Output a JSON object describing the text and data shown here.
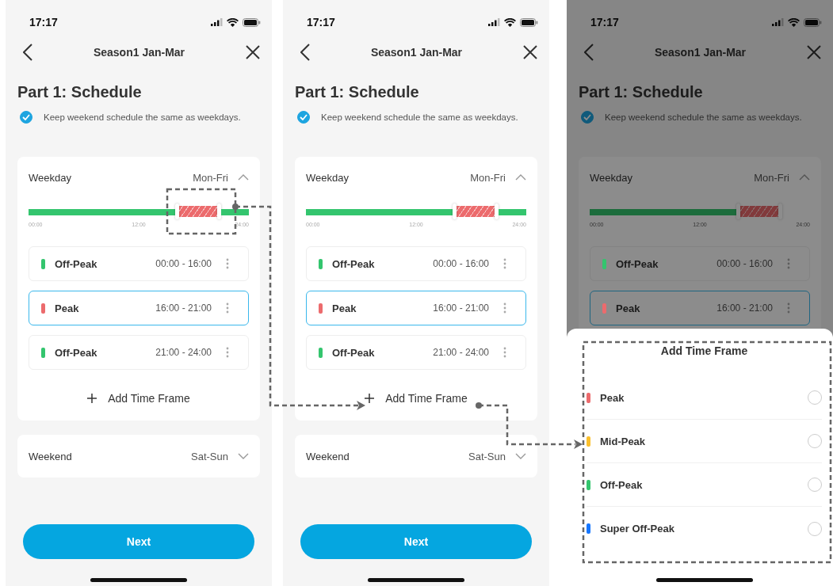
{
  "screens": [
    {
      "status_time": "17:17",
      "title": "Season1 Jan-Mar",
      "heading": "Part 1: Schedule",
      "keep_same": {
        "label": "Keep weekend schedule the same as weekdays.",
        "checked": true
      },
      "weekday": {
        "label": "Weekday",
        "days": "Mon-Fri",
        "expanded": true,
        "ticks": [
          "00:00",
          "12:00",
          "24:00"
        ],
        "frames": [
          {
            "label": "Off-Peak",
            "time": "00:00 - 16:00",
            "color": "#34c56e",
            "selected": false
          },
          {
            "label": "Peak",
            "time": "16:00 - 21:00",
            "color": "#ec6b6d",
            "selected": true
          },
          {
            "label": "Off-Peak",
            "time": "21:00 - 24:00",
            "color": "#34c56e",
            "selected": false
          }
        ],
        "add_label": "Add Time Frame"
      },
      "weekend": {
        "label": "Weekend",
        "days": "Sat-Sun",
        "expanded": false
      },
      "next_button": "Next"
    },
    {
      "status_time": "17:17",
      "title": "Season1 Jan-Mar",
      "heading": "Part 1: Schedule",
      "keep_same": {
        "label": "Keep weekend schedule the same as weekdays.",
        "checked": true
      },
      "weekday": {
        "label": "Weekday",
        "days": "Mon-Fri",
        "expanded": true,
        "ticks": [
          "00:00",
          "12:00",
          "24:00"
        ],
        "frames": [
          {
            "label": "Off-Peak",
            "time": "00:00 - 16:00",
            "color": "#34c56e",
            "selected": false
          },
          {
            "label": "Peak",
            "time": "16:00 - 21:00",
            "color": "#ec6b6d",
            "selected": true
          },
          {
            "label": "Off-Peak",
            "time": "21:00 - 24:00",
            "color": "#34c56e",
            "selected": false
          }
        ],
        "add_label": "Add Time Frame"
      },
      "weekend": {
        "label": "Weekend",
        "days": "Sat-Sun",
        "expanded": false
      },
      "next_button": "Next"
    },
    {
      "status_time": "17:17",
      "title": "Season1 Jan-Mar",
      "heading": "Part 1: Schedule",
      "keep_same": {
        "label": "Keep weekend schedule the same as weekdays.",
        "checked": true
      },
      "weekday": {
        "label": "Weekday",
        "days": "Mon-Fri",
        "expanded": true,
        "ticks": [
          "00:00",
          "12:00",
          "24:00"
        ],
        "frames": [
          {
            "label": "Off-Peak",
            "time": "00:00 - 16:00",
            "color": "#34c56e",
            "selected": false
          },
          {
            "label": "Peak",
            "time": "16:00 - 21:00",
            "color": "#ec6b6d",
            "selected": true
          }
        ]
      },
      "sheet": {
        "title": "Add Time Frame",
        "options": [
          {
            "label": "Peak",
            "color": "#ec6b6d",
            "selected": false
          },
          {
            "label": "Mid-Peak",
            "color": "#fbc02d",
            "selected": false
          },
          {
            "label": "Off-Peak",
            "color": "#34c56e",
            "selected": false
          },
          {
            "label": "Super Off-Peak",
            "color": "#1677ff",
            "selected": false
          }
        ]
      }
    }
  ]
}
